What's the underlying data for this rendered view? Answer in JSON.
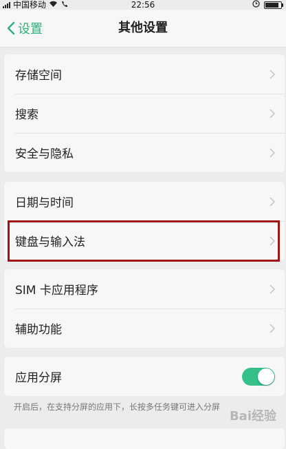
{
  "status": {
    "carrier": "中国移动",
    "time": "22:56",
    "battery_level": 0.85
  },
  "header": {
    "back_label": "设置",
    "title": "其他设置"
  },
  "groups": {
    "g1": [
      "存储空间",
      "搜索",
      "安全与隐私"
    ],
    "g2": [
      "日期与时间",
      "键盘与输入法"
    ],
    "g3": [
      "SIM 卡应用程序",
      "辅助功能"
    ]
  },
  "split_screen": {
    "label": "应用分屏",
    "enabled": true,
    "hint": "开启后，在支持分屏的应用下，长按多任务键可进入分屏"
  },
  "watermark": "Bai经验",
  "colors": {
    "accent": "#2fb07c",
    "highlight_border": "#9e1414"
  }
}
